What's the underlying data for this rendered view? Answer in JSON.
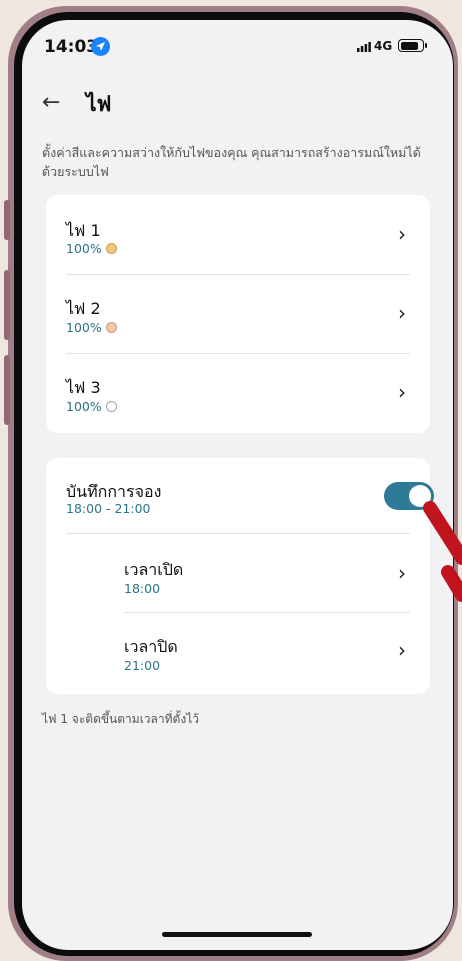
{
  "status": {
    "time": "14:03",
    "network": "4G",
    "icons": [
      "location-icon",
      "signal-icon",
      "battery-icon"
    ]
  },
  "header": {
    "back_icon": "←",
    "title": "ไฟ"
  },
  "description": "ตั้งค่าสีและความสว่างให้กับไฟของคุณ คุณสามารถสร้างอารมณ์ใหม่ได้ด้วยระบบไฟ",
  "lights": [
    {
      "name": "ไฟ 1",
      "level": "100%",
      "color": "#f3c77c"
    },
    {
      "name": "ไฟ 2",
      "level": "100%",
      "color": "#f3c7a8"
    },
    {
      "name": "ไฟ 3",
      "level": "100%",
      "color": "#ffffff"
    }
  ],
  "schedule": {
    "title": "บันทึกการจอง",
    "range": "18:00 - 21:00",
    "enabled": true,
    "on_label": "เวลาเปิด",
    "on_time": "18:00",
    "off_label": "เวลาปิด",
    "off_time": "21:00"
  },
  "footnote": "ไฟ 1 จะติดขึ้นตามเวลาที่ตั้งไว้",
  "colors": {
    "accent": "#2f7a95",
    "subtext": "#2a7488",
    "background": "#f2f2f5",
    "pointer": "#c0141e"
  }
}
